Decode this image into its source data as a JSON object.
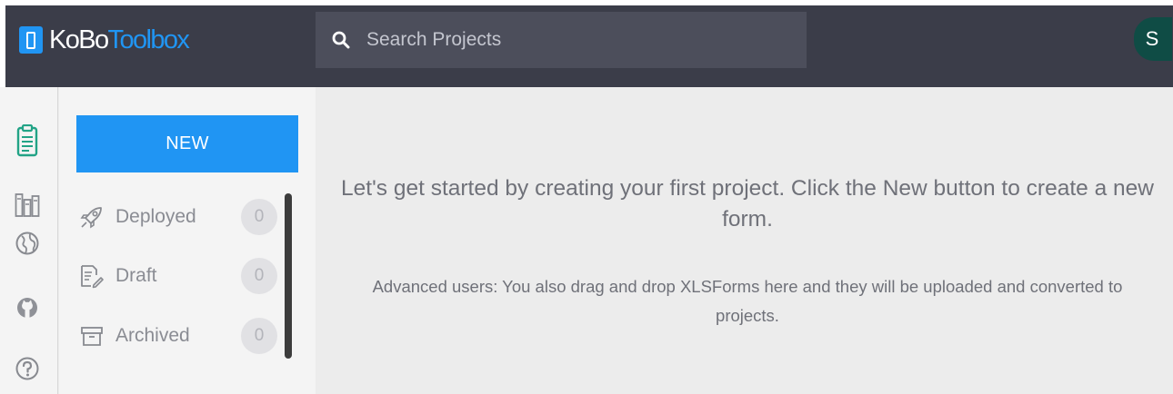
{
  "header": {
    "logo_primary": "KoBo",
    "logo_secondary": "Toolbox",
    "search_placeholder": "Search Projects",
    "avatar_initial": "S"
  },
  "rail": {
    "icons": [
      "clipboard-icon",
      "library-icon",
      "globe-icon",
      "github-icon",
      "help-icon"
    ]
  },
  "sidebar": {
    "new_button_label": "NEW",
    "statuses": [
      {
        "label": "Deployed",
        "count": "0",
        "icon": "rocket-icon"
      },
      {
        "label": "Draft",
        "count": "0",
        "icon": "draft-icon"
      },
      {
        "label": "Archived",
        "count": "0",
        "icon": "archive-icon"
      }
    ]
  },
  "main": {
    "heading": "Let's get started by creating your first project. Click the New button to create a new form.",
    "subtext": "Advanced users: You also drag and drop XLSForms here and they will be uploaded and converted to projects."
  },
  "colors": {
    "accent": "#2095f3",
    "header_bg": "#3b3d49",
    "avatar_bg": "#0f4c45"
  }
}
